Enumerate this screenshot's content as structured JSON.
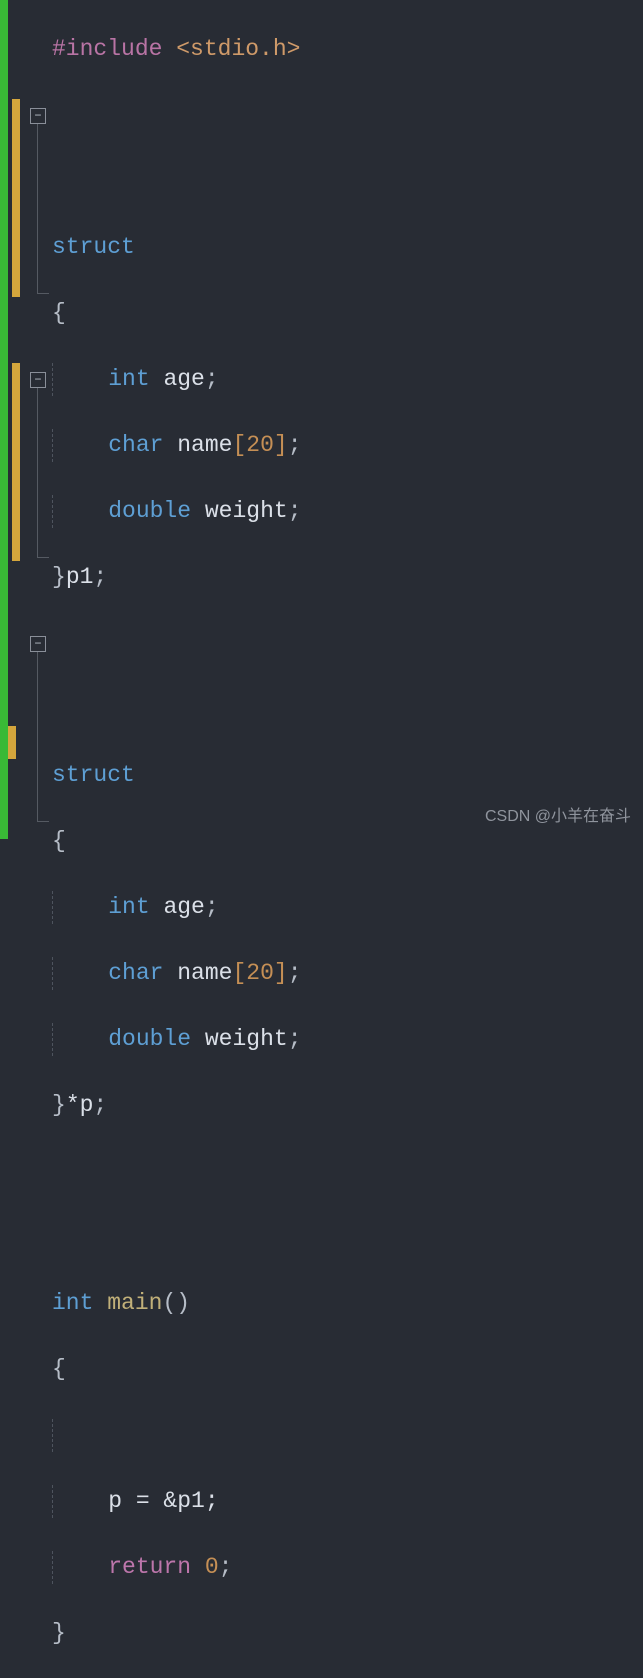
{
  "code": {
    "include": "#include",
    "header": "<stdio.h>",
    "struct": "struct",
    "int_t": "int",
    "char_t": "char",
    "double_t": "double",
    "age": "age",
    "name": "name",
    "arr": "[20]",
    "weight": "weight",
    "p1": "p1",
    "star_p": "*p",
    "main": "main",
    "parens": "()",
    "p_assign": "p = &p1;",
    "ret": "return",
    "zero": "0",
    "semi": ";",
    "brace_open": "{",
    "brace_close": "}",
    "brace_close_p1": "}p1;",
    "brace_close_sp": "}*p;"
  },
  "fold_symbol": "−",
  "watermark": "CSDN @小羊在奋斗"
}
